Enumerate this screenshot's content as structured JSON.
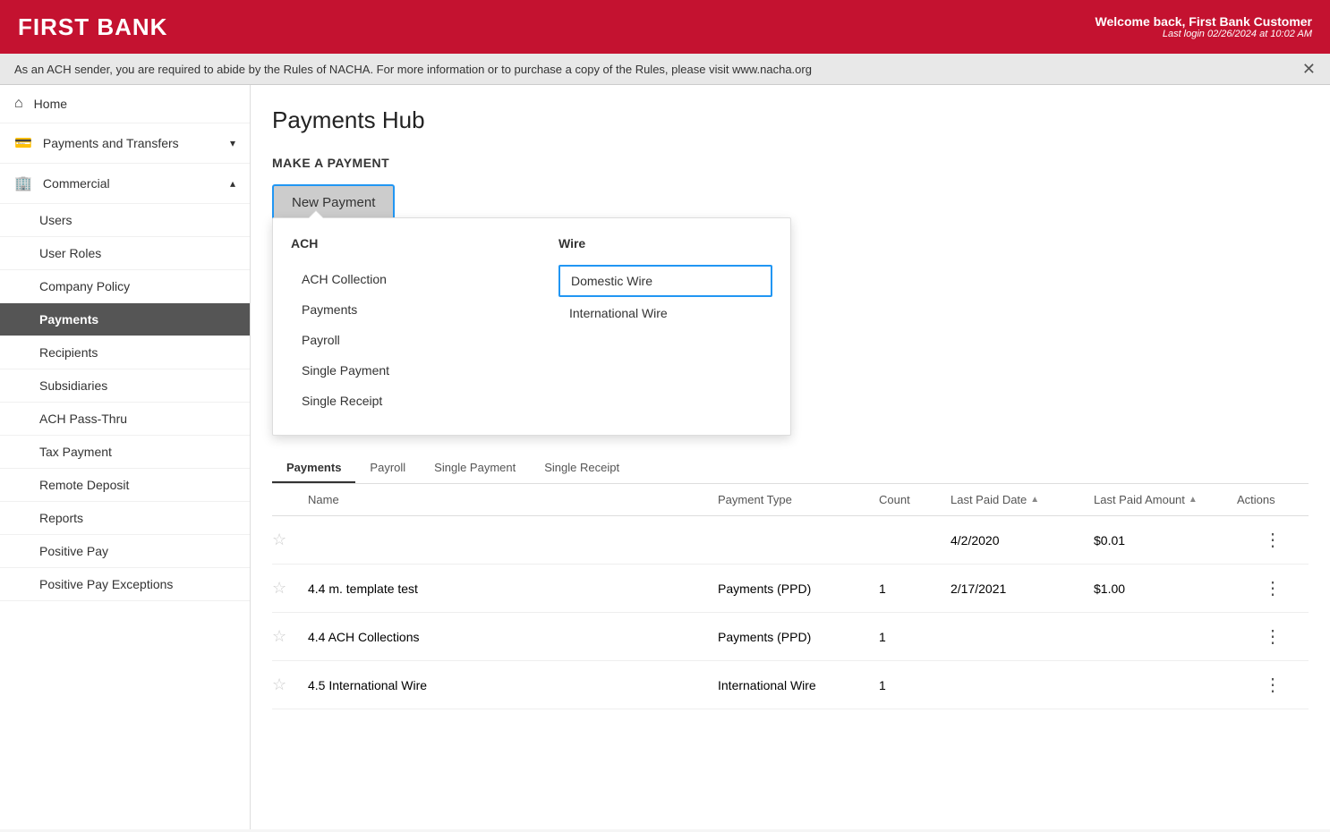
{
  "header": {
    "logo": "FIRST BANK",
    "welcome": "Welcome back, First Bank Customer",
    "last_login": "Last login 02/26/2024 at 10:02 AM"
  },
  "notice": {
    "text": "As an ACH sender, you are required to abide by the Rules of NACHA. For more information or to purchase a copy of the Rules, please visit www.nacha.org"
  },
  "sidebar": {
    "items": [
      {
        "id": "home",
        "label": "Home",
        "icon": "⌂",
        "indent": false
      },
      {
        "id": "payments-transfers",
        "label": "Payments and Transfers",
        "icon": "💳",
        "indent": false,
        "chevron": "▾"
      },
      {
        "id": "commercial",
        "label": "Commercial",
        "icon": "🏢",
        "indent": false,
        "chevron": "▴"
      },
      {
        "id": "users",
        "label": "Users",
        "indent": true
      },
      {
        "id": "user-roles",
        "label": "User Roles",
        "indent": true
      },
      {
        "id": "company-policy",
        "label": "Company Policy",
        "indent": true
      },
      {
        "id": "payments",
        "label": "Payments",
        "indent": true,
        "active": true
      },
      {
        "id": "recipients",
        "label": "Recipients",
        "indent": true
      },
      {
        "id": "subsidiaries",
        "label": "Subsidiaries",
        "indent": true
      },
      {
        "id": "ach-pass-thru",
        "label": "ACH Pass-Thru",
        "indent": true
      },
      {
        "id": "tax-payment",
        "label": "Tax Payment",
        "indent": true
      },
      {
        "id": "remote-deposit",
        "label": "Remote Deposit",
        "indent": true
      },
      {
        "id": "reports",
        "label": "Reports",
        "indent": true
      },
      {
        "id": "positive-pay",
        "label": "Positive Pay",
        "indent": true
      },
      {
        "id": "positive-pay-exceptions",
        "label": "Positive Pay Exceptions",
        "indent": true
      }
    ]
  },
  "main": {
    "page_title": "Payments Hub",
    "section_title": "MAKE A PAYMENT",
    "new_payment_btn": "New Payment",
    "dropdown": {
      "ach_header": "ACH",
      "wire_header": "Wire",
      "ach_items": [
        "ACH Collection",
        "Payments",
        "Payroll",
        "Single Payment",
        "Single Receipt"
      ],
      "wire_items": [
        "Domestic Wire",
        "International Wire"
      ],
      "selected_wire": "Domestic Wire"
    },
    "tabs": [
      "Payments",
      "Payroll",
      "Single Payment",
      "Single Receipt"
    ],
    "table": {
      "headers": [
        "",
        "Name",
        "Payment Type",
        "Count",
        "Last Paid Date",
        "Last Paid Amount",
        "Actions"
      ],
      "rows": [
        {
          "name": "",
          "type": "",
          "count": "",
          "last_paid_date": "4/2/2020",
          "last_paid_amount": "$0.01"
        },
        {
          "name": "4.4 m. template test",
          "type": "Payments (PPD)",
          "count": "1",
          "last_paid_date": "2/17/2021",
          "last_paid_amount": "$1.00"
        },
        {
          "name": "4.4 ACH Collections",
          "type": "Payments (PPD)",
          "count": "1",
          "last_paid_date": "",
          "last_paid_amount": ""
        },
        {
          "name": "4.5 International Wire",
          "type": "International Wire",
          "count": "1",
          "last_paid_date": "",
          "last_paid_amount": ""
        }
      ]
    }
  }
}
